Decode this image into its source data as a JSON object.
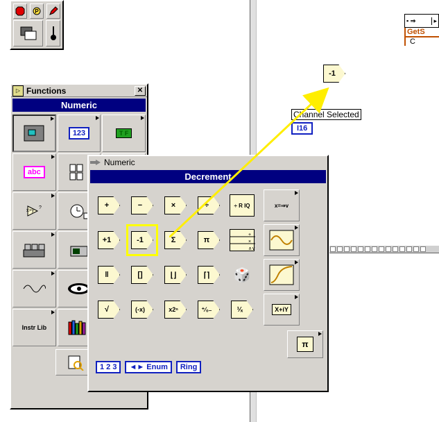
{
  "tools": {
    "items": [
      "stop",
      "probe",
      "pencil",
      "rects",
      "brush"
    ]
  },
  "functions_window": {
    "title": "Functions",
    "subpalette_title": "Numeric",
    "cells": [
      {
        "name": "structures",
        "label": ""
      },
      {
        "name": "numeric",
        "label": "123",
        "boxed": true,
        "active": true
      },
      {
        "name": "boolean",
        "label": "T F",
        "boxed": true,
        "bg": "#20a020"
      },
      {
        "name": "string",
        "label": "abc",
        "boxed": true,
        "bg": "#ff60ff"
      },
      {
        "name": "array",
        "label": ""
      },
      {
        "name": "cluster",
        "label": ""
      },
      {
        "name": "comparison",
        "label": ""
      },
      {
        "name": "time",
        "label": ""
      },
      {
        "name": "dialog",
        "label": ""
      },
      {
        "name": "file-io",
        "label": ""
      },
      {
        "name": "instrument-io",
        "label": ""
      },
      {
        "name": "waveform",
        "label": ""
      },
      {
        "name": "signal",
        "label": ""
      },
      {
        "name": "vision",
        "label": ""
      },
      {
        "name": "app-control",
        "label": ""
      },
      {
        "name": "instr-lib",
        "label": "Instr Lib"
      },
      {
        "name": "libraries",
        "label": ""
      },
      {
        "name": "graphics",
        "label": ""
      }
    ]
  },
  "numeric_window": {
    "title": "Numeric",
    "selected_label": "Decrement",
    "grid": [
      [
        {
          "name": "add",
          "glyph": "+"
        },
        {
          "name": "subtract",
          "glyph": "−"
        },
        {
          "name": "multiply",
          "glyph": "×"
        },
        {
          "name": "divide",
          "glyph": "÷"
        },
        {
          "name": "quotient-remainder",
          "glyph": "÷ R IQ"
        }
      ],
      [
        {
          "name": "increment",
          "glyph": "+1"
        },
        {
          "name": "decrement",
          "glyph": "-1",
          "highlighted": true
        },
        {
          "name": "sum",
          "glyph": "Σ"
        },
        {
          "name": "product",
          "glyph": "π"
        },
        {
          "name": "compound-arith",
          "glyph": ""
        }
      ],
      [
        {
          "name": "abs",
          "glyph": "‖"
        },
        {
          "name": "round",
          "glyph": "[]"
        },
        {
          "name": "floor",
          "glyph": "⌊⌋"
        },
        {
          "name": "ceil",
          "glyph": "⌈⌉"
        },
        {
          "name": "random",
          "glyph": "🎲"
        }
      ],
      [
        {
          "name": "sqrt",
          "glyph": "√"
        },
        {
          "name": "negate",
          "glyph": "(-x)"
        },
        {
          "name": "power2",
          "glyph": "x2ⁿ"
        },
        {
          "name": "sign",
          "glyph": "⁺⁄₀₋"
        },
        {
          "name": "reciprocal",
          "glyph": "¹⁄ₓ"
        }
      ]
    ],
    "side_cells": [
      {
        "name": "conversion",
        "glyph": "x=⇒v"
      },
      {
        "name": "trig",
        "glyph": "~"
      },
      {
        "name": "logarithmic",
        "glyph": "∫"
      },
      {
        "name": "complex",
        "glyph": "X+iY"
      },
      {
        "name": "constants",
        "glyph": "π"
      }
    ],
    "bottom_buttons": [
      {
        "name": "numeric-constant",
        "label": "1 2 3"
      },
      {
        "name": "enum-constant",
        "label": "◄► Enum"
      },
      {
        "name": "ring-constant",
        "label": "Ring"
      }
    ]
  },
  "canvas": {
    "label": "Channel Selected",
    "type_box": "I16",
    "dropped_node_glyph": "-1",
    "right_label": "GetS",
    "right_sub": "C"
  }
}
